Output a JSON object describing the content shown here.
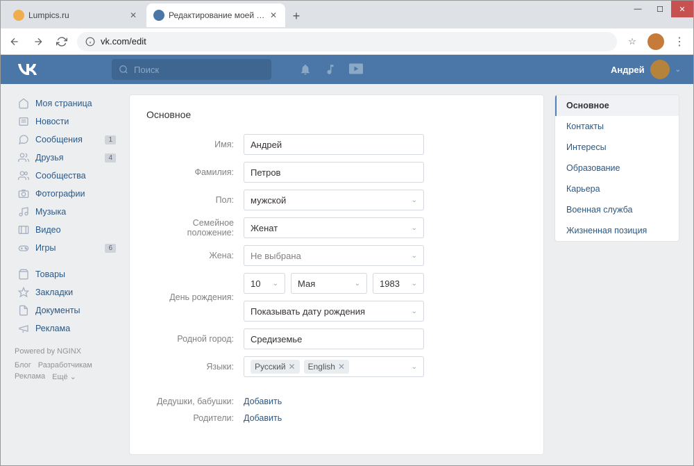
{
  "browser": {
    "tabs": [
      {
        "title": "Lumpics.ru",
        "favicon_color": "#f0ad4e"
      },
      {
        "title": "Редактирование моей страниц",
        "favicon_color": "#4a76a8"
      }
    ],
    "url_display": "vk.com/edit"
  },
  "vk_header": {
    "search_placeholder": "Поиск",
    "username": "Андрей"
  },
  "sidebar": {
    "items": [
      {
        "label": "Моя страница",
        "icon": "home",
        "badge": ""
      },
      {
        "label": "Новости",
        "icon": "news",
        "badge": ""
      },
      {
        "label": "Сообщения",
        "icon": "msg",
        "badge": "1"
      },
      {
        "label": "Друзья",
        "icon": "friends",
        "badge": "4"
      },
      {
        "label": "Сообщества",
        "icon": "groups",
        "badge": ""
      },
      {
        "label": "Фотографии",
        "icon": "photo",
        "badge": ""
      },
      {
        "label": "Музыка",
        "icon": "music",
        "badge": ""
      },
      {
        "label": "Видео",
        "icon": "video",
        "badge": ""
      },
      {
        "label": "Игры",
        "icon": "games",
        "badge": "6"
      }
    ],
    "items2": [
      {
        "label": "Товары"
      },
      {
        "label": "Закладки"
      },
      {
        "label": "Документы"
      },
      {
        "label": "Реклама"
      }
    ],
    "powered": "Powered by NGINX",
    "footer": [
      "Блог",
      "Разработчикам",
      "Реклама",
      "Ещё ⌄"
    ]
  },
  "form": {
    "title": "Основное",
    "labels": {
      "name": "Имя:",
      "surname": "Фамилия:",
      "gender": "Пол:",
      "marital": "Семейное положение:",
      "spouse": "Жена:",
      "birthday": "День рождения:",
      "hometown": "Родной город:",
      "languages": "Языки:",
      "grandparents": "Дедушки, бабушки:",
      "parents": "Родители:"
    },
    "values": {
      "name": "Андрей",
      "surname": "Петров",
      "gender": "мужской",
      "marital": "Женат",
      "spouse": "Не выбрана",
      "bd_day": "10",
      "bd_month": "Мая",
      "bd_year": "1983",
      "bd_visibility": "Показывать дату рождения",
      "hometown": "Средиземье"
    },
    "languages": [
      "Русский",
      "English"
    ],
    "add_action": "Добавить"
  },
  "rightnav": {
    "items": [
      "Основное",
      "Контакты",
      "Интересы",
      "Образование",
      "Карьера",
      "Военная служба",
      "Жизненная позиция"
    ]
  }
}
